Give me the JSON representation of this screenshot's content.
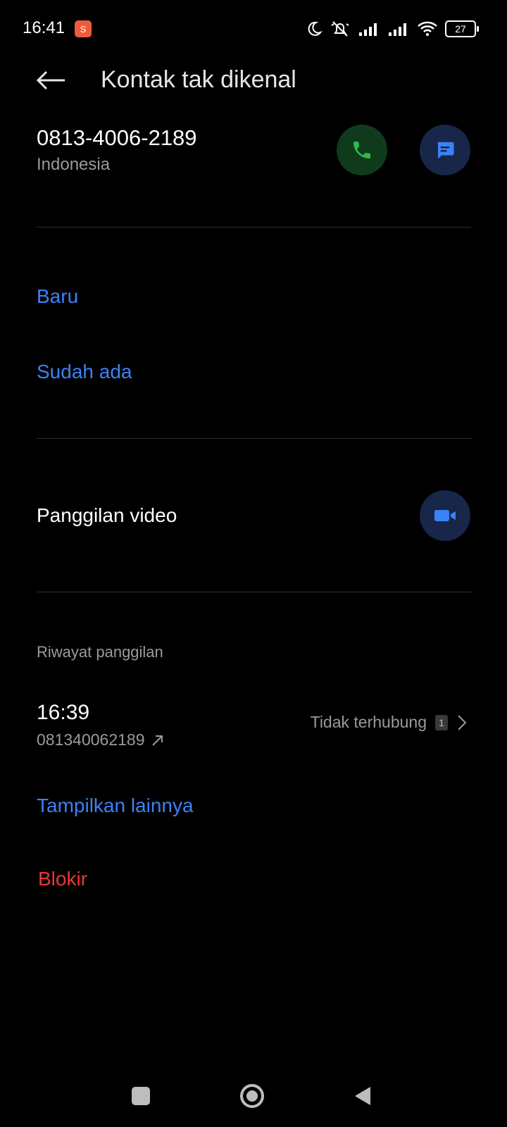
{
  "status_bar": {
    "time": "16:41",
    "battery": "27",
    "icons": [
      "moon-icon",
      "silent-icon",
      "signal-icon",
      "signal-icon",
      "wifi-icon",
      "battery-icon"
    ]
  },
  "header": {
    "title": "Kontak tak dikenal"
  },
  "contact": {
    "number": "0813-4006-2189",
    "country": "Indonesia"
  },
  "add_contact": {
    "new_label": "Baru",
    "existing_label": "Sudah ada"
  },
  "video_call": {
    "label": "Panggilan video"
  },
  "call_history": {
    "section_label": "Riwayat panggilan",
    "entries": [
      {
        "time": "16:39",
        "number": "081340062189",
        "status": "Tidak terhubung",
        "sim": "1"
      }
    ]
  },
  "actions": {
    "show_more_label": "Tampilkan lainnya",
    "block_label": "Blokir"
  },
  "colors": {
    "accent_blue": "#3b82f6",
    "danger_red": "#e53935",
    "call_green": "#2fb84f",
    "background": "#000000"
  }
}
